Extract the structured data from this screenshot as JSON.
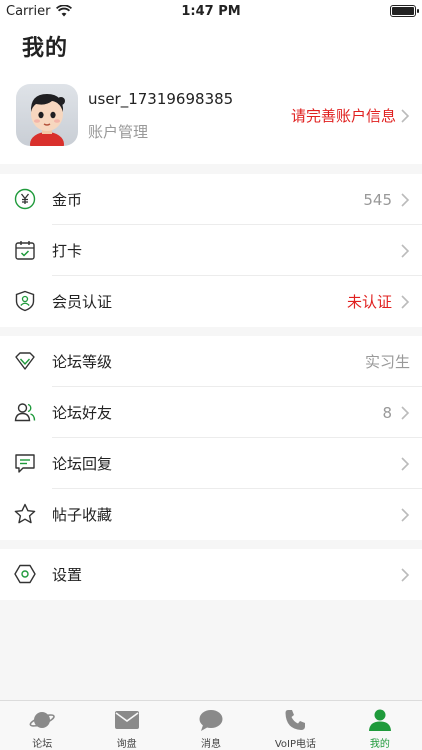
{
  "status_bar": {
    "carrier": "Carrier",
    "time": "1:47 PM"
  },
  "header": {
    "title": "我的",
    "username": "user_17319698385",
    "account_management": "账户管理",
    "complete_info": "请完善账户信息"
  },
  "group1": [
    {
      "label": "金币",
      "value": "545",
      "icon": "coin-icon"
    },
    {
      "label": "打卡",
      "value": "",
      "icon": "calendar-check-icon"
    },
    {
      "label": "会员认证",
      "value": "未认证",
      "icon": "shield-user-icon"
    }
  ],
  "group2": [
    {
      "label": "论坛等级",
      "value": "实习生",
      "icon": "diamond-icon"
    },
    {
      "label": "论坛好友",
      "value": "8",
      "icon": "friends-icon"
    },
    {
      "label": "论坛回复",
      "value": "",
      "icon": "chat-reply-icon"
    },
    {
      "label": "帖子收藏",
      "value": "",
      "icon": "star-icon"
    }
  ],
  "group3": [
    {
      "label": "设置",
      "value": "",
      "icon": "settings-hexagon-icon"
    }
  ],
  "tabbar": [
    {
      "label": "论坛",
      "icon": "planet-icon"
    },
    {
      "label": "询盘",
      "icon": "mail-icon"
    },
    {
      "label": "消息",
      "icon": "chat-bubble-icon"
    },
    {
      "label": "VoIP电话",
      "icon": "phone-icon"
    },
    {
      "label": "我的",
      "icon": "person-icon",
      "active": true
    }
  ],
  "colors": {
    "accent_red": "#e0201f",
    "accent_green": "#1f9a3b",
    "muted": "#999999"
  }
}
